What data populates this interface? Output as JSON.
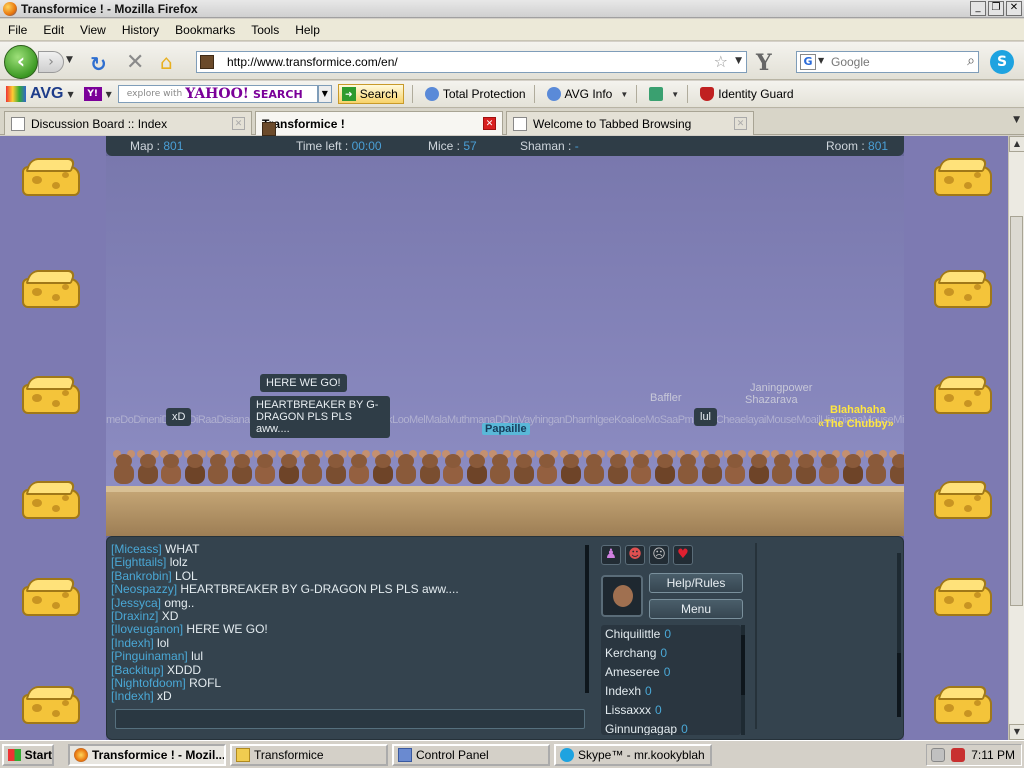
{
  "window": {
    "title": "Transformice ! - Mozilla Firefox"
  },
  "menu": [
    "File",
    "Edit",
    "View",
    "History",
    "Bookmarks",
    "Tools",
    "Help"
  ],
  "nav": {
    "url": "http://www.transformice.com/en/",
    "search_placeholder": "Google",
    "search_engine_icon": "G"
  },
  "avg_toolbar": {
    "brand": "AVG",
    "yahoo_placeholder": "explore with",
    "yahoo_brand": "YAHOO!",
    "yahoo_search_word": "SEARCH",
    "search_label": "Search",
    "total_protection": "Total Protection",
    "avg_info": "AVG Info",
    "identity_guard": "Identity Guard"
  },
  "tabs": [
    {
      "label": "Discussion Board :: Index",
      "active": false
    },
    {
      "label": "Transformice !",
      "active": true
    },
    {
      "label": "Welcome to Tabbed Browsing",
      "active": false
    }
  ],
  "game": {
    "status": {
      "map_label": "Map :",
      "map_value": "801",
      "time_label": "Time left :",
      "time_value": "00:00",
      "mice_label": "Mice :",
      "mice_value": "57",
      "shaman_label": "Shaman :",
      "shaman_value": "-",
      "room_label": "Room :",
      "room_value": "801"
    },
    "bubbles": [
      "HERE WE GO!",
      "HEARTBREAKER BY G-DRAGON PLS PLS aww....",
      "xD",
      "lul"
    ],
    "nametags": {
      "papaille": "Papaille",
      "baffler": "Baffler",
      "janingpower": "Janingpower",
      "shazarava": "Shazarava",
      "blahahaha": "Blahahaha",
      "chubby_title": "«The Chubby»"
    },
    "chat": [
      {
        "name": "[Miceass]",
        "msg": "WHAT"
      },
      {
        "name": "[Eighttails]",
        "msg": "lolz"
      },
      {
        "name": "[Bankrobin]",
        "msg": "LOL"
      },
      {
        "name": "[Neospazzy]",
        "msg": "HEARTBREAKER BY G-DRAGON PLS PLS aww...."
      },
      {
        "name": "[Jessyca]",
        "msg": "omg.."
      },
      {
        "name": "[Draxinz]",
        "msg": "XD"
      },
      {
        "name": "[Iloveuganon]",
        "msg": "HERE WE GO!"
      },
      {
        "name": "[Indexh]",
        "msg": "lol"
      },
      {
        "name": "[Pinguinaman]",
        "msg": "lul"
      },
      {
        "name": "[Backitup]",
        "msg": "XDDD"
      },
      {
        "name": "[Nightofdoom]",
        "msg": "ROFL"
      },
      {
        "name": "[Indexh]",
        "msg": "xD"
      }
    ],
    "buttons": {
      "help": "Help/Rules",
      "menu": "Menu"
    },
    "players": [
      {
        "name": "Chiquilittle",
        "score": "0"
      },
      {
        "name": "Kerchang",
        "score": "0"
      },
      {
        "name": "Ameseree",
        "score": "0"
      },
      {
        "name": "Indexh",
        "score": "0"
      },
      {
        "name": "Lissaxxx",
        "score": "0"
      },
      {
        "name": "Ginnungagap",
        "score": "0"
      }
    ]
  },
  "taskbar": {
    "start": "Start",
    "items": [
      {
        "label": "Transformice ! - Mozil...",
        "active": true
      },
      {
        "label": "Transformice",
        "active": false
      },
      {
        "label": "Control Panel",
        "active": false
      },
      {
        "label": "Skype™ - mr.kookyblah",
        "active": false
      }
    ],
    "clock": "7:11 PM"
  }
}
